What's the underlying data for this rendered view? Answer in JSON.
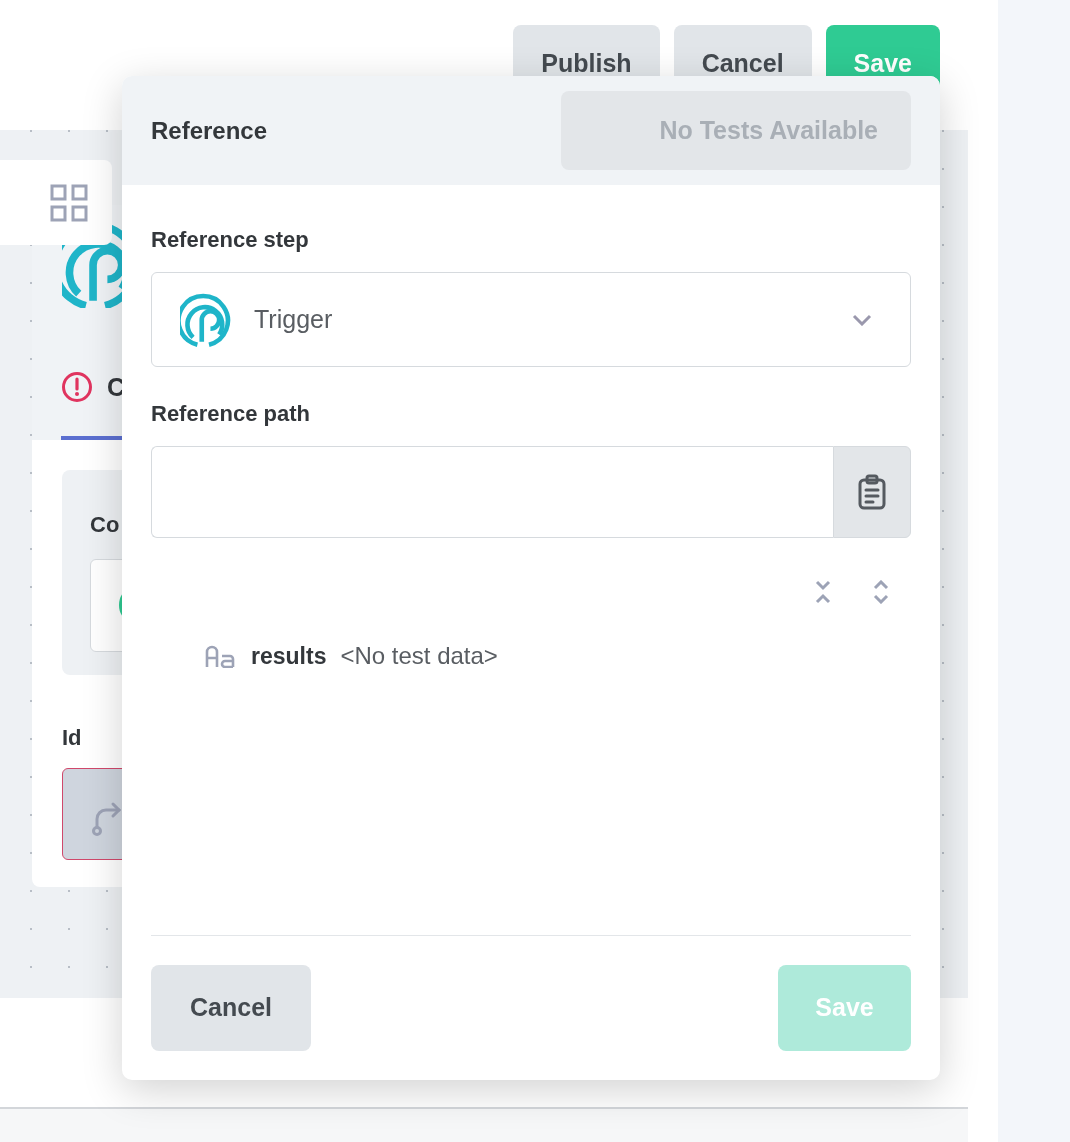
{
  "header_buttons": [
    {
      "label": "Publish",
      "kind": "secondary"
    },
    {
      "label": "Cancel",
      "kind": "secondary"
    },
    {
      "label": "Save",
      "kind": "primary"
    }
  ],
  "step_panel": {
    "tab": {
      "label": "C",
      "error": true
    },
    "config_label": "Co",
    "id_label": "Id",
    "id_field": {
      "invalid": true
    }
  },
  "dialog": {
    "title": "Reference",
    "test_button": {
      "label": "No Tests Available",
      "disabled": true
    },
    "step_label": "Reference step",
    "step_select": {
      "value": "Trigger"
    },
    "path_label": "Reference path",
    "tree": [
      {
        "name": "results",
        "value": "<No test data>"
      }
    ],
    "footer": [
      {
        "label": "Cancel",
        "kind": "secondary",
        "disabled": false
      },
      {
        "label": "Save",
        "kind": "primary",
        "disabled": true
      }
    ]
  }
}
